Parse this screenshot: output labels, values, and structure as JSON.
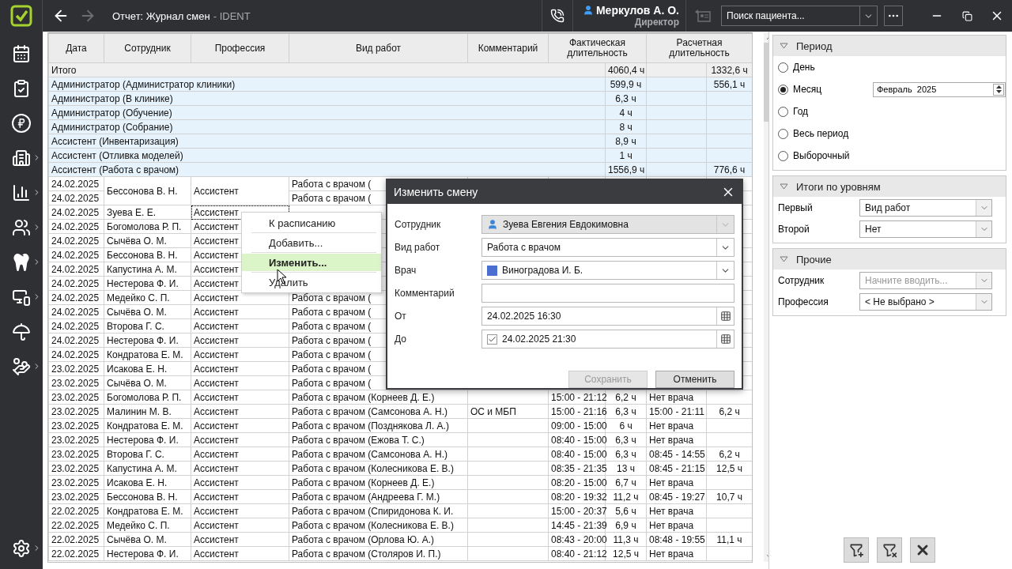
{
  "topbar": {
    "title": "Отчет: Журнал смен",
    "subtitle": "- IDENT",
    "back_enabled": true,
    "forward_enabled": false,
    "contact_enabled": false,
    "user": {
      "name": "Меркулов А. О.",
      "role": "Директор"
    },
    "patient_search": {
      "placeholder": "Поиск пациента..."
    }
  },
  "sidebar": {
    "items": [
      {
        "submenu": false
      },
      {
        "submenu": false
      },
      {
        "submenu": false
      },
      {
        "submenu": true
      },
      {
        "submenu": true
      },
      {
        "submenu": true
      },
      {
        "submenu": true
      },
      {
        "submenu": true
      },
      {
        "submenu": false
      },
      {
        "submenu": true
      }
    ],
    "settings": {
      "submenu": true
    }
  },
  "table": {
    "columns": [
      {
        "label": "Дата"
      },
      {
        "label": "Сотрудник"
      },
      {
        "label": "Профессия"
      },
      {
        "label": "Вид работ"
      },
      {
        "label": "Комментарий"
      },
      {
        "label": "Фактическая длительность"
      },
      {
        "label": "Расчетная длительность"
      }
    ],
    "rows": [
      {
        "kind": "total",
        "label": "Итого",
        "actual_hours": "4060,4 ч",
        "calc_hours": "1332,6 ч"
      },
      {
        "kind": "group",
        "label": "Администратор (Администратор клиники)",
        "actual_hours": "599,9 ч",
        "calc_hours": "556,1 ч"
      },
      {
        "kind": "group",
        "label": "Администратор (В клинике)",
        "actual_hours": "6,3 ч"
      },
      {
        "kind": "group",
        "label": "Администратор (Обучение)",
        "actual_hours": "4 ч"
      },
      {
        "kind": "group",
        "label": "Администратор (Собрание)",
        "actual_hours": "8 ч"
      },
      {
        "kind": "group",
        "label": "Ассистент (Инвентаризация)",
        "actual_hours": "8,9 ч"
      },
      {
        "kind": "group",
        "label": "Ассистент (Отливка моделей)",
        "actual_hours": "1 ч"
      },
      {
        "kind": "group",
        "label": "Ассистент (Работа с врачом)",
        "actual_hours": "1556,9 ч",
        "calc_hours": "776,6 ч"
      },
      {
        "kind": "shift",
        "date": "24.02.2025",
        "employee": "Бессонова В. Н.",
        "profession": "Ассистент",
        "work_type": "Работа с врачом (",
        "continued": false,
        "focused": false
      },
      {
        "kind": "shift",
        "date": "24.02.2025",
        "work_type": "Работа с врачом (",
        "continued": true
      },
      {
        "kind": "shift",
        "date": "24.02.2025",
        "employee": "Зуева Е. Е.",
        "profession": "Ассистент",
        "continued": false,
        "focused": true
      },
      {
        "kind": "shift",
        "date": "24.02.2025",
        "employee": "Богомолова Р. П.",
        "profession": "Ассистент",
        "continued": false,
        "focused": false
      },
      {
        "kind": "shift",
        "date": "24.02.2025",
        "employee": "Сычёва О. М.",
        "profession": "Ассистент",
        "continued": false,
        "focused": false
      },
      {
        "kind": "shift",
        "date": "24.02.2025",
        "employee": "Бессонова В. Н.",
        "profession": "Ассистент",
        "continued": false,
        "focused": false
      },
      {
        "kind": "shift",
        "date": "24.02.2025",
        "employee": "Капустина А. М.",
        "profession": "Ассистент",
        "continued": false,
        "focused": false
      },
      {
        "kind": "shift",
        "date": "24.02.2025",
        "employee": "Нестерова Ф. И.",
        "profession": "Ассистент",
        "continued": false,
        "focused": false
      },
      {
        "kind": "shift",
        "date": "24.02.2025",
        "employee": "Медейко С. П.",
        "profession": "Ассистент",
        "work_type": "Работа с врачом (",
        "continued": false,
        "focused": false
      },
      {
        "kind": "shift",
        "date": "24.02.2025",
        "employee": "Сычёва О. М.",
        "profession": "Ассистент",
        "work_type": "Работа с врачом (",
        "continued": false,
        "focused": false
      },
      {
        "kind": "shift",
        "date": "24.02.2025",
        "employee": "Второва Г. С.",
        "profession": "Ассистент",
        "work_type": "Работа с врачом (",
        "continued": false,
        "focused": false
      },
      {
        "kind": "shift",
        "date": "24.02.2025",
        "employee": "Нестерова Ф. И.",
        "profession": "Ассистент",
        "work_type": "Работа с врачом (",
        "continued": false,
        "focused": false
      },
      {
        "kind": "shift",
        "date": "24.02.2025",
        "employee": "Кондратова Е. М.",
        "profession": "Ассистент",
        "work_type": "Работа с врачом (",
        "continued": false,
        "focused": false
      },
      {
        "kind": "shift",
        "date": "23.02.2025",
        "employee": "Исакова Е. Н.",
        "profession": "Ассистент",
        "work_type": "Работа с врачом (",
        "continued": false,
        "focused": false
      },
      {
        "kind": "shift",
        "date": "23.02.2025",
        "employee": "Сычёва О. М.",
        "profession": "Ассистент",
        "work_type": "Работа с врачом (",
        "continued": false,
        "focused": false
      },
      {
        "kind": "shift",
        "date": "23.02.2025",
        "employee": "Богомолова Р. П.",
        "profession": "Ассистент",
        "work_type": "Работа с врачом (Корнеев Д. Е.)",
        "actual_time": "15:00 - 21:12",
        "actual_hours": "6,2 ч",
        "calc_time": "Нет врача",
        "continued": false,
        "focused": false
      },
      {
        "kind": "shift",
        "date": "23.02.2025",
        "employee": "Малинин М. В.",
        "profession": "Ассистент",
        "work_type": "Работа с врачом (Самсонова А. Н.)",
        "comment": "ОС и МБП",
        "actual_time": "15:00 - 21:16",
        "actual_hours": "6,3 ч",
        "calc_time": "15:00 - 21:11",
        "calc_hours": "6,2 ч",
        "continued": false,
        "focused": false
      },
      {
        "kind": "shift",
        "date": "23.02.2025",
        "employee": "Кондратова Е. М.",
        "profession": "Ассистент",
        "work_type": "Работа с врачом (Позднякова Л. А.)",
        "actual_time": "09:00 - 15:00",
        "actual_hours": "6 ч",
        "calc_time": "Нет врача",
        "continued": false,
        "focused": false
      },
      {
        "kind": "shift",
        "date": "23.02.2025",
        "employee": "Нестерова Ф. И.",
        "profession": "Ассистент",
        "work_type": "Работа с врачом (Ежова Т. С.)",
        "actual_time": "08:40 - 15:00",
        "actual_hours": "6,3 ч",
        "calc_time": "Нет врача",
        "continued": false,
        "focused": false
      },
      {
        "kind": "shift",
        "date": "23.02.2025",
        "employee": "Второва Г. С.",
        "profession": "Ассистент",
        "work_type": "Работа с врачом (Самсонова А. Н.)",
        "actual_time": "08:40 - 15:00",
        "actual_hours": "6,3 ч",
        "calc_time": "08:45 - 14:55",
        "calc_hours": "6,2 ч",
        "continued": false,
        "focused": false
      },
      {
        "kind": "shift",
        "date": "23.02.2025",
        "employee": "Капустина А. М.",
        "profession": "Ассистент",
        "work_type": "Работа с врачом (Колесникова Е. В.)",
        "actual_time": "08:35 - 21:35",
        "actual_hours": "13 ч",
        "calc_time": "08:45 - 21:15",
        "calc_hours": "12,5 ч",
        "continued": false,
        "focused": false
      },
      {
        "kind": "shift",
        "date": "23.02.2025",
        "employee": "Исакова Е. Н.",
        "profession": "Ассистент",
        "work_type": "Работа с врачом (Корнеев Д. Е.)",
        "actual_time": "08:20 - 15:00",
        "actual_hours": "6,7 ч",
        "calc_time": "Нет врача",
        "continued": false,
        "focused": false
      },
      {
        "kind": "shift",
        "date": "23.02.2025",
        "employee": "Бессонова В. Н.",
        "profession": "Ассистент",
        "work_type": "Работа с врачом (Андреева Г. М.)",
        "actual_time": "08:20 - 19:32",
        "actual_hours": "11,2 ч",
        "calc_time": "08:45 - 19:27",
        "calc_hours": "10,7 ч",
        "continued": false,
        "focused": false
      },
      {
        "kind": "shift",
        "date": "22.02.2025",
        "employee": "Кондратова Е. М.",
        "profession": "Ассистент",
        "work_type": "Работа с врачом (Спиридонова К. И.",
        "actual_time": "15:00 - 20:37",
        "actual_hours": "5,6 ч",
        "calc_time": "Нет врача",
        "continued": false,
        "focused": false
      },
      {
        "kind": "shift",
        "date": "22.02.2025",
        "employee": "Медейко С. П.",
        "profession": "Ассистент",
        "work_type": "Работа с врачом (Колесникова Е. В.)",
        "actual_time": "14:45 - 21:39",
        "actual_hours": "6,9 ч",
        "calc_time": "Нет врача",
        "continued": false,
        "focused": false
      },
      {
        "kind": "shift",
        "date": "22.02.2025",
        "employee": "Сычёва О. М.",
        "profession": "Ассистент",
        "work_type": "Работа с врачом (Орлова Ю. А.)",
        "actual_time": "08:43 - 20:00",
        "actual_hours": "11,3 ч",
        "calc_time": "08:48 - 19:55",
        "calc_hours": "11,1 ч",
        "continued": false,
        "focused": false
      },
      {
        "kind": "shift",
        "date": "22.02.2025",
        "employee": "Нестерова Ф. И.",
        "profession": "Ассистент",
        "work_type": "Работа с врачом (Столяров И. П.)",
        "actual_time": "08:40 - 21:12",
        "actual_hours": "12,5 ч",
        "calc_time": "Нет врача",
        "continued": false,
        "focused": false
      }
    ]
  },
  "context_menu": {
    "items": [
      {
        "label": "К расписанию",
        "selected": false
      },
      {
        "label": "Добавить...",
        "selected": false
      },
      {
        "label": "Изменить...",
        "selected": true
      },
      {
        "label": "Удалить",
        "selected": false
      }
    ]
  },
  "dialog": {
    "title": "Изменить смену",
    "fields": [
      {
        "kind": "employee",
        "label": "Сотрудник",
        "value": "Зуева Евгения Евдокимовна",
        "disabled": true
      },
      {
        "kind": "combo",
        "label": "Вид работ",
        "value": "Работа с врачом",
        "disabled": false
      },
      {
        "kind": "doctor",
        "label": "Врач",
        "value": "Виноградова И. Б.",
        "color": "#4a6fd0",
        "disabled": false
      },
      {
        "kind": "text",
        "label": "Комментарий",
        "disabled": false
      },
      {
        "kind": "datetime",
        "label": "От",
        "value": "24.02.2025 16:30",
        "disabled": false
      },
      {
        "kind": "datetime_check",
        "label": "До",
        "value": "24.02.2025 21:30",
        "checked": true,
        "disabled": false
      }
    ],
    "buttons": [
      {
        "label": "Сохранить",
        "disabled": true
      },
      {
        "label": "Отменить",
        "disabled": false
      }
    ]
  },
  "filters": {
    "period": {
      "title": "Период",
      "options": [
        {
          "label": "День",
          "selected": false
        },
        {
          "label": "Месяц",
          "selected": true,
          "value": "Февраль  2025"
        },
        {
          "label": "Год",
          "selected": false
        },
        {
          "label": "Весь период",
          "selected": false
        },
        {
          "label": "Выборочный",
          "selected": false
        }
      ]
    },
    "levels": {
      "title": "Итоги по уровням",
      "rows": [
        {
          "label": "Первый",
          "value": "Вид работ"
        },
        {
          "label": "Второй",
          "value": "Нет"
        }
      ]
    },
    "other": {
      "title": "Прочие",
      "rows": [
        {
          "label": "Сотрудник",
          "placeholder": "Начните вводить..."
        },
        {
          "label": "Профессия",
          "value": "< Не выбрано >"
        }
      ]
    }
  }
}
